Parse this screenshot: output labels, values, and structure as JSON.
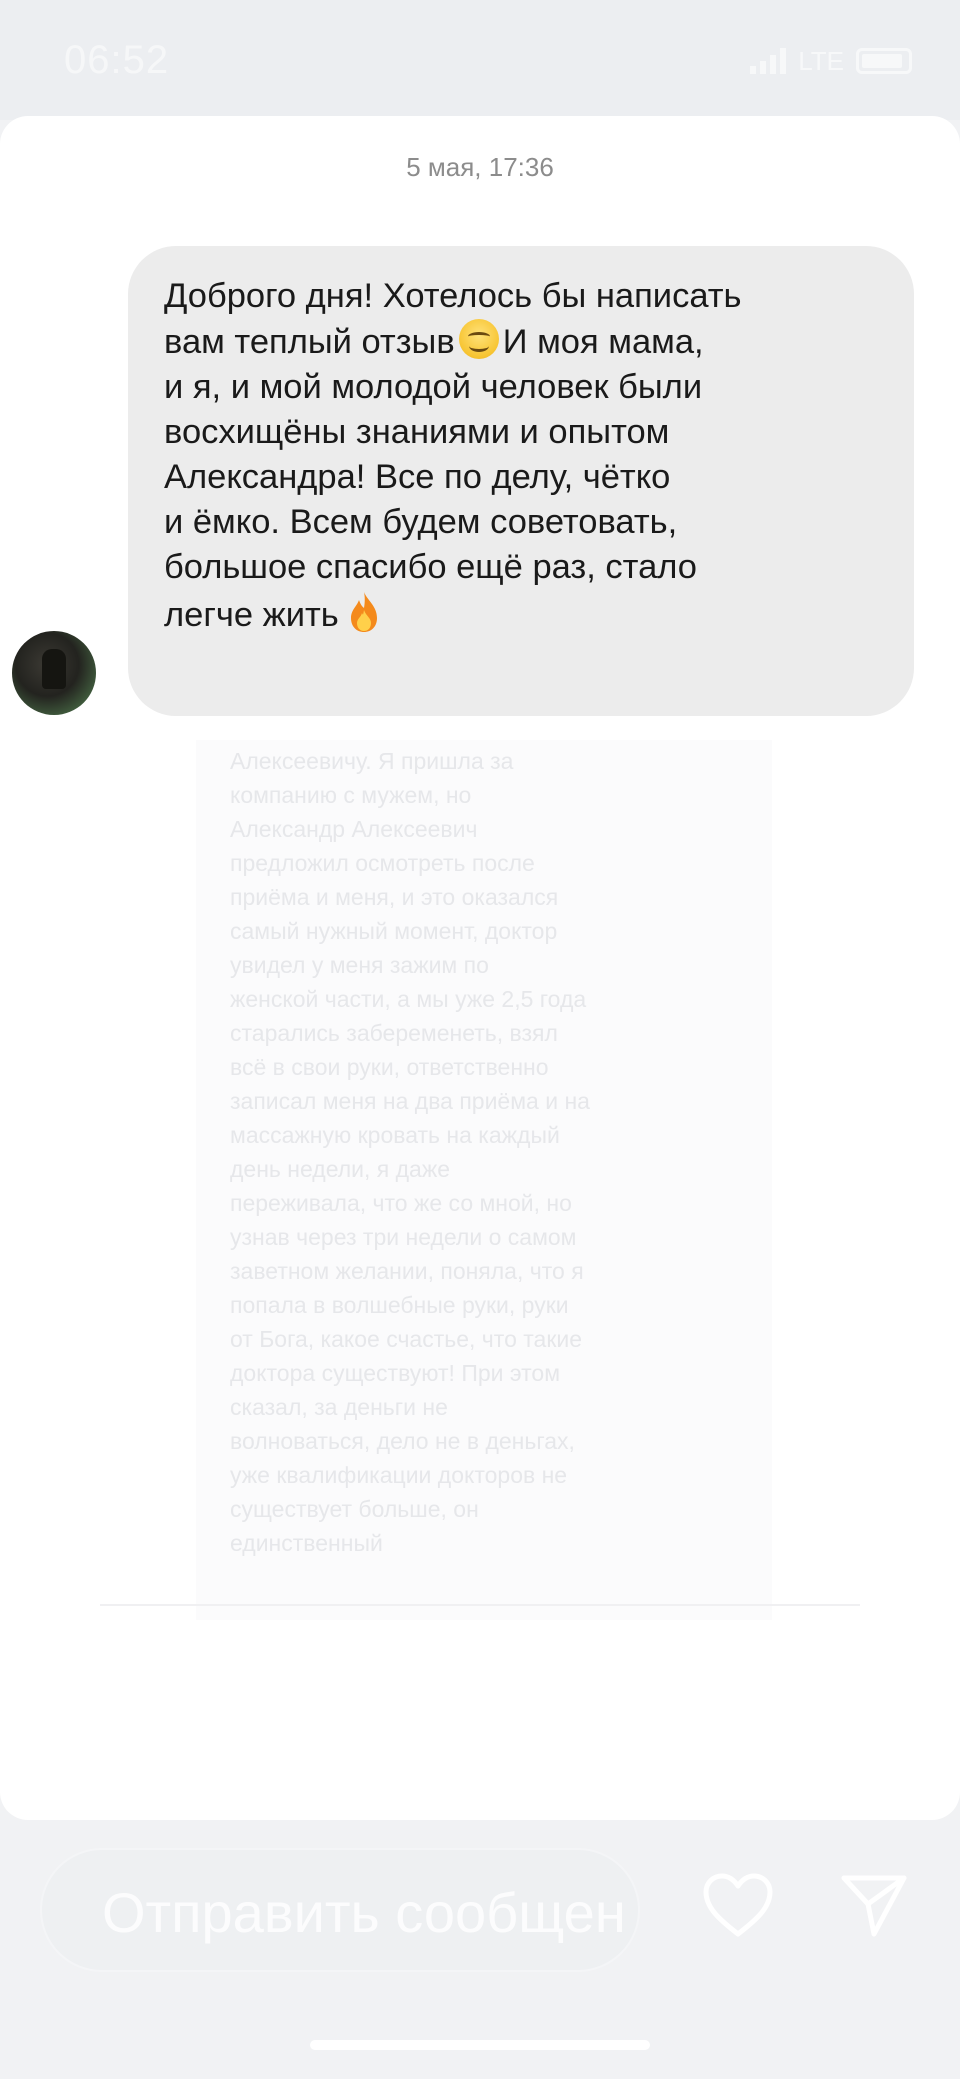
{
  "status_bar": {
    "time": "06:52",
    "network": "LTE"
  },
  "chat": {
    "timestamp": "5 мая, 17:36",
    "message": {
      "lines": [
        "Доброго дня! Хотелось бы написать",
        "вам теплый отзыв",
        "И моя мама,",
        "и я, и мой молодой человек были",
        "восхищёны знаниями и опытом",
        "Александра! Все по делу, чётко",
        "и ёмко. Всем будем советовать,",
        "большое спасибо ещё раз, стало",
        "легче жить"
      ],
      "emojis": [
        "smiling-face-emoji",
        "fire-emoji"
      ]
    },
    "faded_lines": [
      "Алексеевичу. Я пришла за",
      "компанию с мужем, но",
      "Александр Алексеевич",
      "предложил осмотреть после",
      "приёма и меня, и это оказался",
      "самый нужный момент, доктор",
      "увидел у меня зажим по",
      "женской части, а мы уже 2,5 года",
      "старались забеременеть, взял",
      "всё в свои руки, ответственно",
      "записал меня на два приёма и на",
      "массажную кровать на каждый",
      "день недели, я даже",
      "переживала, что же со мной, но",
      "узнав через три недели о самом",
      "заветном желании, поняла, что я",
      "попала в волшебные руки, руки",
      "от Бога, какое счастье, что такие",
      "доктора существуют! При этом",
      "сказал, за деньги не",
      "волноваться, дело не в деньгах,",
      "уже квалификации докторов не",
      "существует больше, он",
      "единственный"
    ]
  },
  "composer": {
    "placeholder": "Отправить сообщение"
  },
  "icons": {
    "like": "heart-icon",
    "send": "send-icon"
  }
}
